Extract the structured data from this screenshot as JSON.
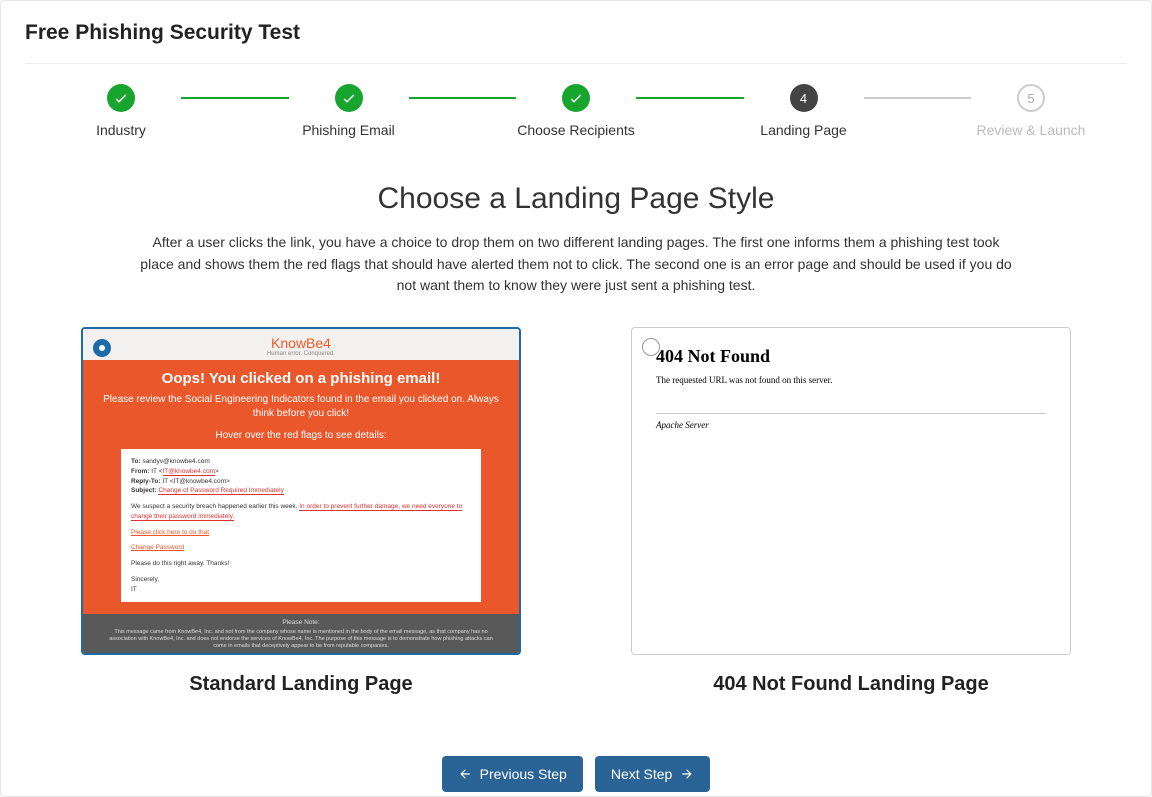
{
  "page_title": "Free Phishing Security Test",
  "stepper": {
    "steps": [
      {
        "label": "Industry",
        "state": "done"
      },
      {
        "label": "Phishing Email",
        "state": "done"
      },
      {
        "label": "Choose Recipients",
        "state": "done"
      },
      {
        "label": "Landing Page",
        "state": "current",
        "number": "4"
      },
      {
        "label": "Review & Launch",
        "state": "todo",
        "number": "5"
      }
    ]
  },
  "section": {
    "heading": "Choose a Landing Page Style",
    "description": "After a user clicks the link, you have a choice to drop them on two different landing pages. The first one informs them a phishing test took place and shows them the red flags that should have alerted them not to click. The second one is an error page and should be used if you do not want them to know they were just sent a phishing test."
  },
  "options": {
    "standard": {
      "label": "Standard Landing Page",
      "selected": true,
      "preview": {
        "logo_name": "KnowBe4",
        "logo_tag": "Human error. Conquered.",
        "h1": "Oops! You clicked on a phishing email!",
        "p1": "Please review the Social Engineering Indicators found in the email you clicked on. Always think before you click!",
        "hover": "Hover over the red flags to see details:",
        "email": {
          "to_label": "To:",
          "to_value": "sandyv@knowbe4.com",
          "from_label": "From:",
          "from_value": "IT <",
          "from_flag": "IT@knowbe4.com",
          "from_close": ">",
          "reply_label": "Reply-To:",
          "reply_value": "IT <IT@knowbe4.com>",
          "subject_label": "Subject:",
          "subject_flag": "Change of Password Required Immediately",
          "body1a": "We suspect a security breach happened earlier this week. ",
          "body1b": "In order to prevent further damage, we need everyone to change their password immediately.",
          "link1": "Please click here to do that",
          "link2": "Change Password",
          "body2": "Please do this right away. Thanks!",
          "sig1": "Sincerely,",
          "sig2": "IT"
        },
        "footer_title": "Please Note:",
        "footer_body": "This message came from KnowBe4, Inc. and not from the company whose name is mentioned in the body of the email message, as that company has no association with KnowBe4, Inc. and does not endorse the services of KnowBe4, Inc. The purpose of this message is to demonstrate how phishing attacks can come in emails that deceptively appear to be from reputable companies."
      }
    },
    "notfound": {
      "label": "404 Not Found Landing Page",
      "selected": false,
      "preview": {
        "h1": "404 Not Found",
        "msg": "The requested URL was not found on this server.",
        "server": "Apache Server"
      }
    }
  },
  "buttons": {
    "prev": "Previous Step",
    "next": "Next Step"
  }
}
